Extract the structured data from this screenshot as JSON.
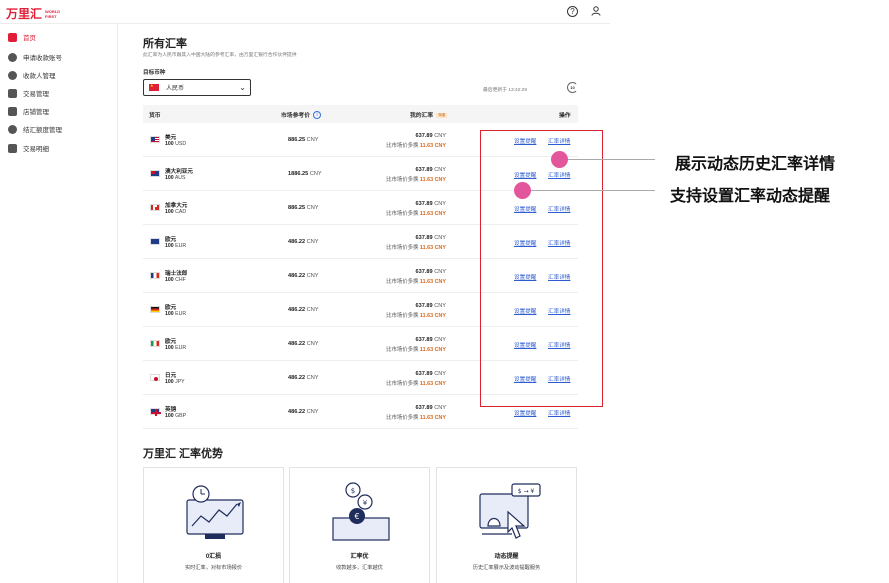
{
  "header": {
    "logo_cn": "万里汇",
    "logo_en": "WORLD FIRST",
    "help_icon": "help-circle-icon",
    "user_icon": "user-icon"
  },
  "sidebar": {
    "items": [
      {
        "label": "首页",
        "icon": "home-icon",
        "active": true
      },
      {
        "label": "申请收款账号",
        "icon": "globe-icon",
        "active": false
      },
      {
        "label": "收款人管理",
        "icon": "user-circle-icon",
        "active": false
      },
      {
        "label": "交易管理",
        "icon": "document-icon",
        "active": false
      },
      {
        "label": "店铺管理",
        "icon": "store-icon",
        "active": false
      },
      {
        "label": "结汇额度管理",
        "icon": "coins-icon",
        "active": false
      },
      {
        "label": "交易明细",
        "icon": "list-icon",
        "active": false
      }
    ]
  },
  "main": {
    "title": "所有汇率",
    "description": "此汇率为人民币跟其入中国大陆的参考汇率，由万里汇银行合作伙伴提供",
    "target_label": "目标币种",
    "target_value": "人民币",
    "last_update": "最后更新于 13:42:29",
    "refresh_badge": "10"
  },
  "table": {
    "headers": {
      "currency": "货币",
      "market": "市场参考价",
      "mine": "我的汇率",
      "mine_badge": "特惠",
      "action": "操作"
    },
    "action_labels": {
      "alert": "设置提醒",
      "detail": "汇率详情"
    },
    "compare_prefix": "比市场价多换",
    "rows": [
      {
        "flag": "us",
        "name": "美元",
        "amount": "100",
        "code": "USD",
        "market": "886.25",
        "market_unit": "CNY",
        "mine": "637.89",
        "mine_unit": "CNY",
        "gain": "11.63 CNY"
      },
      {
        "flag": "au",
        "name": "澳大利亚元",
        "amount": "100",
        "code": "AUS",
        "market": "1886.25",
        "market_unit": "CNY",
        "mine": "637.89",
        "mine_unit": "CNY",
        "gain": "11.63 CNY"
      },
      {
        "flag": "ca",
        "name": "加拿大元",
        "amount": "100",
        "code": "CAD",
        "market": "886.25",
        "market_unit": "CNY",
        "mine": "637.89",
        "mine_unit": "CNY",
        "gain": "11.63 CNY"
      },
      {
        "flag": "eu",
        "name": "欧元",
        "amount": "100",
        "code": "EUR",
        "market": "486.22",
        "market_unit": "CNY",
        "mine": "637.89",
        "mine_unit": "CNY",
        "gain": "11.63 CNY"
      },
      {
        "flag": "fr",
        "name": "瑞士法郎",
        "amount": "100",
        "code": "CHF",
        "market": "486.22",
        "market_unit": "CNY",
        "mine": "637.89",
        "mine_unit": "CNY",
        "gain": "11.63 CNY"
      },
      {
        "flag": "de",
        "name": "欧元",
        "amount": "100",
        "code": "EUR",
        "market": "486.22",
        "market_unit": "CNY",
        "mine": "637.89",
        "mine_unit": "CNY",
        "gain": "11.63 CNY"
      },
      {
        "flag": "it",
        "name": "欧元",
        "amount": "100",
        "code": "EUR",
        "market": "486.22",
        "market_unit": "CNY",
        "mine": "637.89",
        "mine_unit": "CNY",
        "gain": "11.63 CNY"
      },
      {
        "flag": "jp",
        "name": "日元",
        "amount": "100",
        "code": "JPY",
        "market": "486.22",
        "market_unit": "CNY",
        "mine": "637.89",
        "mine_unit": "CNY",
        "gain": "11.63 CNY"
      },
      {
        "flag": "gb",
        "name": "英镑",
        "amount": "100",
        "code": "GBP",
        "market": "486.22",
        "market_unit": "CNY",
        "mine": "637.89",
        "mine_unit": "CNY",
        "gain": "11.63 CNY"
      }
    ]
  },
  "callouts": {
    "detail": "展示动态历史汇率详情",
    "alert": "支持设置汇率动态提醒"
  },
  "advantages": {
    "title": "万里汇 汇率优势",
    "cards": [
      {
        "title": "0汇损",
        "desc": "实时汇率，对标市场报价",
        "icon": "chart-monitor-icon"
      },
      {
        "title": "汇率优",
        "desc": "收款越多，汇率越优",
        "icon": "coins-stack-icon"
      },
      {
        "title": "动态提醒",
        "desc": "历史汇率展示及波动提醒服务",
        "icon": "bell-alert-icon"
      }
    ],
    "exchange_glyph": "$ → ¥"
  },
  "colors": {
    "brand": "#e01f36",
    "link": "#2d5bd0",
    "gain": "#d9691a",
    "highlight": "#d92330",
    "dot": "#e2569b"
  }
}
